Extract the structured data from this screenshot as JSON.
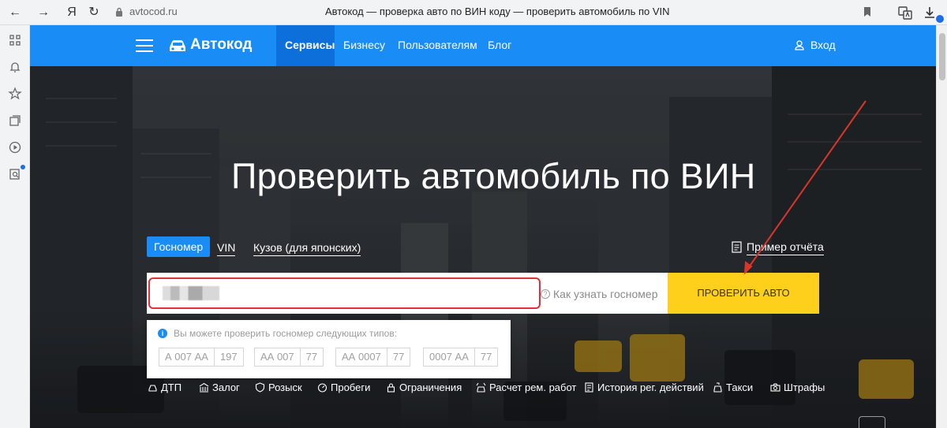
{
  "browser": {
    "back": "←",
    "forward": "→",
    "yandex": "Я",
    "reload": "↻",
    "domain": "avtocod.ru",
    "tab_title": "Автокод — проверка авто по ВИН коду — проверить автомобиль по VIN"
  },
  "header": {
    "logo": "Автокод",
    "nav": [
      "Сервисы",
      "Бизнесу",
      "Пользователям",
      "Блог"
    ],
    "login": "Вход"
  },
  "hero": {
    "title": "Проверить автомобиль по ВИН",
    "tabs": [
      "Госномер",
      "VIN",
      "Кузов (для японских)"
    ],
    "sample_report": "Пример отчёта",
    "search_value": "",
    "search_placeholder": "",
    "help_link": "Как узнать госномер",
    "check_button": "ПРОВЕРИТЬ АВТО",
    "hint": {
      "text": "Вы можете проверить госномер следующих типов:",
      "plates": [
        [
          "А 007 АА",
          "197"
        ],
        [
          "АА 007",
          "77"
        ],
        [
          "АА 0007",
          "77"
        ],
        [
          "0007 АА",
          "77"
        ]
      ]
    },
    "services": [
      "ДТП",
      "Залог",
      "Розыск",
      "Пробеги",
      "Ограничения",
      "Расчет рем. работ",
      "История рег. действий",
      "Такси",
      "Штрафы"
    ]
  },
  "colors": {
    "brand_blue": "#1a8cf6",
    "nav_active": "#0d6fd9",
    "check_yellow": "#ffd01b",
    "highlight_red": "#e0303a"
  }
}
